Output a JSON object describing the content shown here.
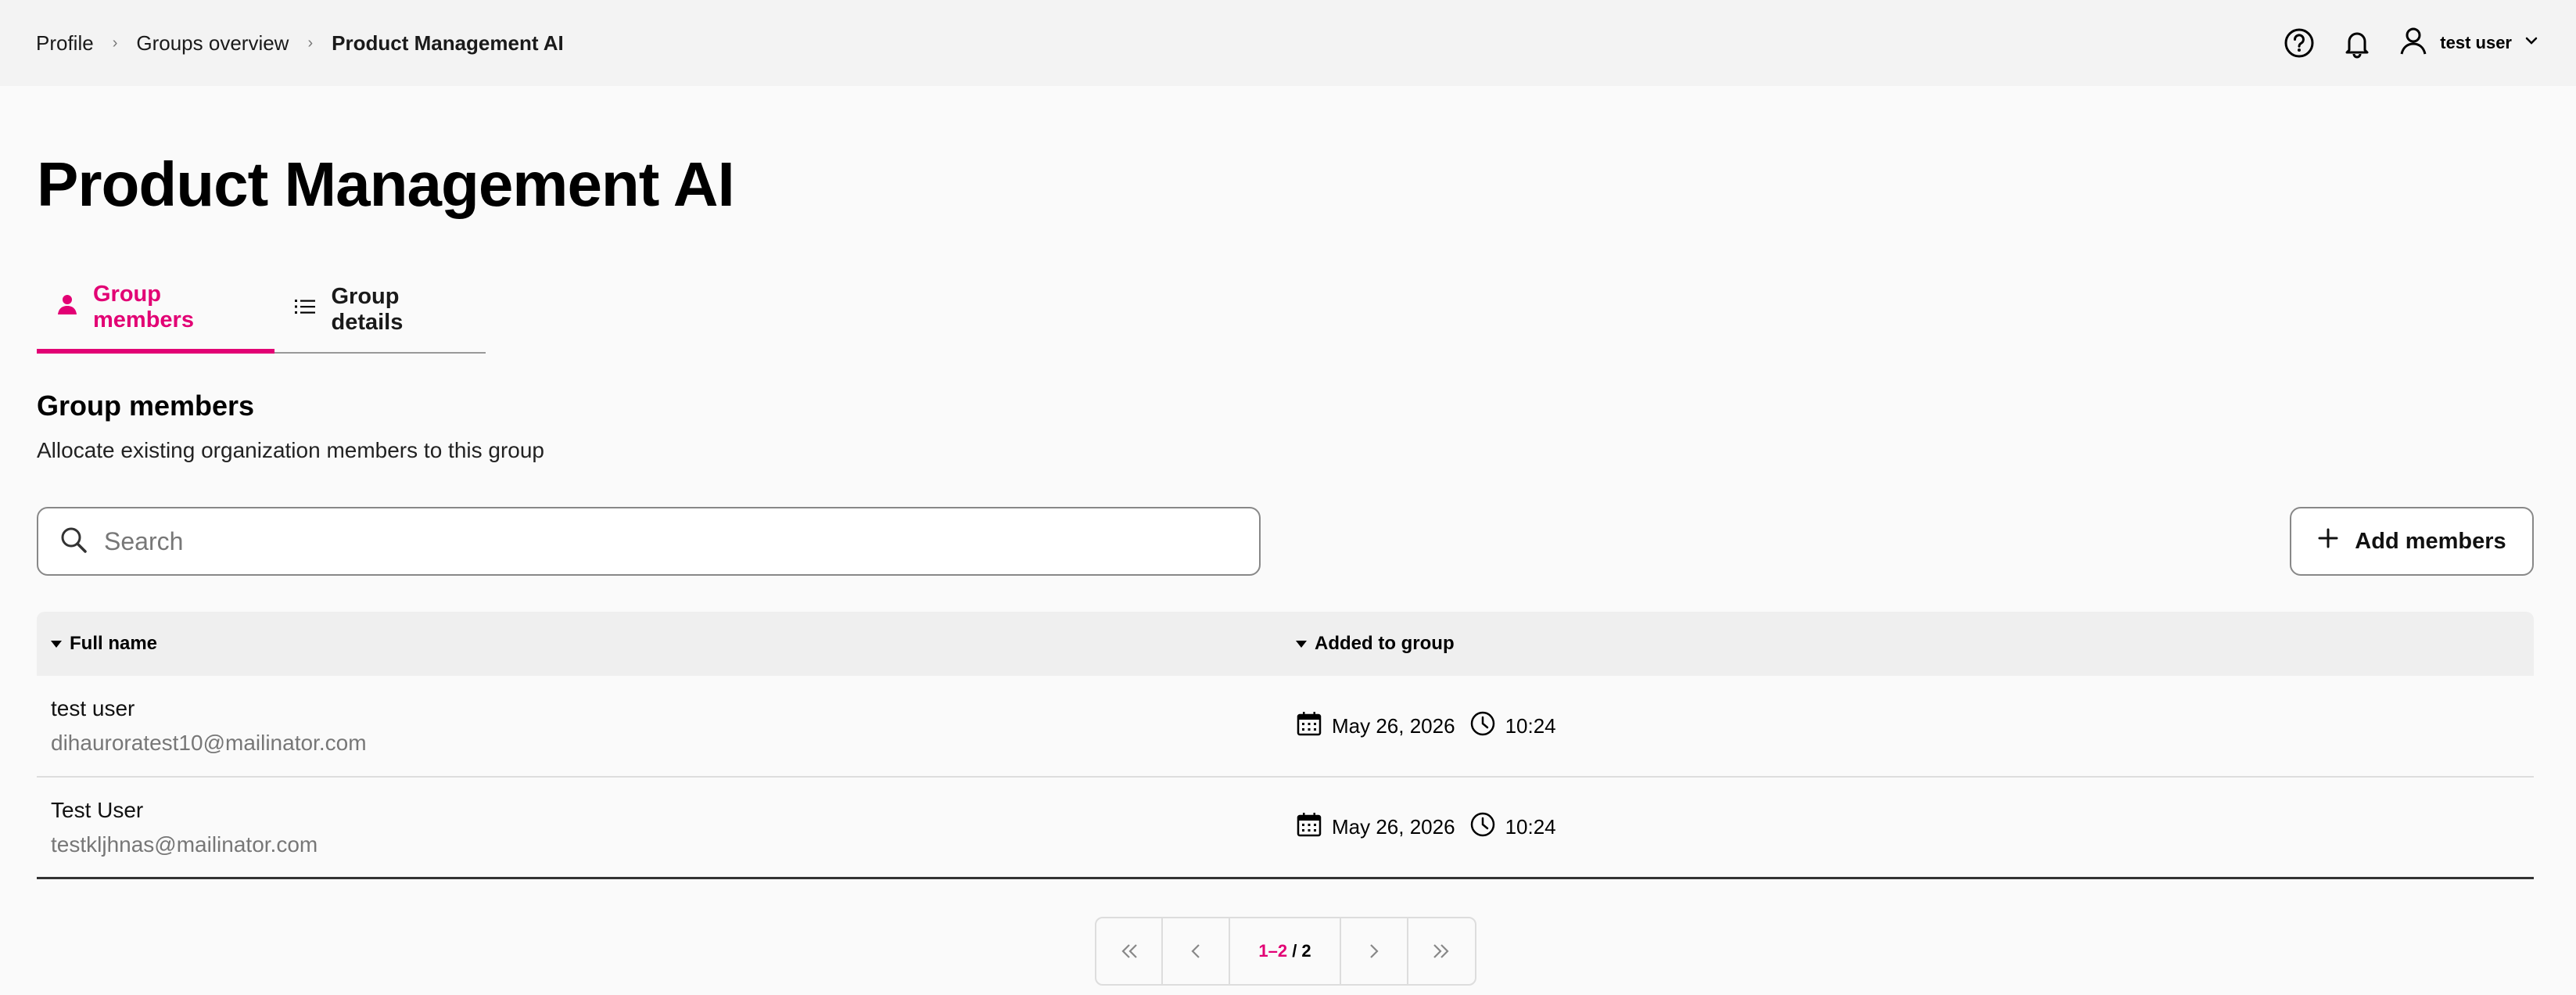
{
  "breadcrumb": {
    "items": [
      "Profile",
      "Groups overview",
      "Product Management AI"
    ]
  },
  "header": {
    "user_name": "test user",
    "icons": [
      "help-icon",
      "bell-icon",
      "user-icon",
      "chevron-down-icon"
    ]
  },
  "page": {
    "title": "Product Management AI"
  },
  "tabs": [
    {
      "label": "Group members",
      "icon": "person-icon",
      "active": true
    },
    {
      "label": "Group details",
      "icon": "list-icon",
      "active": false
    }
  ],
  "section": {
    "title": "Group members",
    "subtitle": "Allocate existing organization members to this group"
  },
  "search": {
    "placeholder": "Search",
    "value": ""
  },
  "actions": {
    "add_members_label": "Add members"
  },
  "table": {
    "columns": [
      "Full name",
      "Added to group"
    ],
    "rows": [
      {
        "name": "test user",
        "email": "dihauroratest10@mailinator.com",
        "date": "May 26, 2026",
        "time": "10:24"
      },
      {
        "name": "Test User",
        "email": "testkljhnas@mailinator.com",
        "date": "May 26, 2026",
        "time": "10:24"
      }
    ]
  },
  "pagination": {
    "range": "1–2",
    "total": "/ 2"
  },
  "colors": {
    "accent": "#e20074",
    "header_bg": "#f3f3f3",
    "table_header_bg": "#efefef"
  }
}
